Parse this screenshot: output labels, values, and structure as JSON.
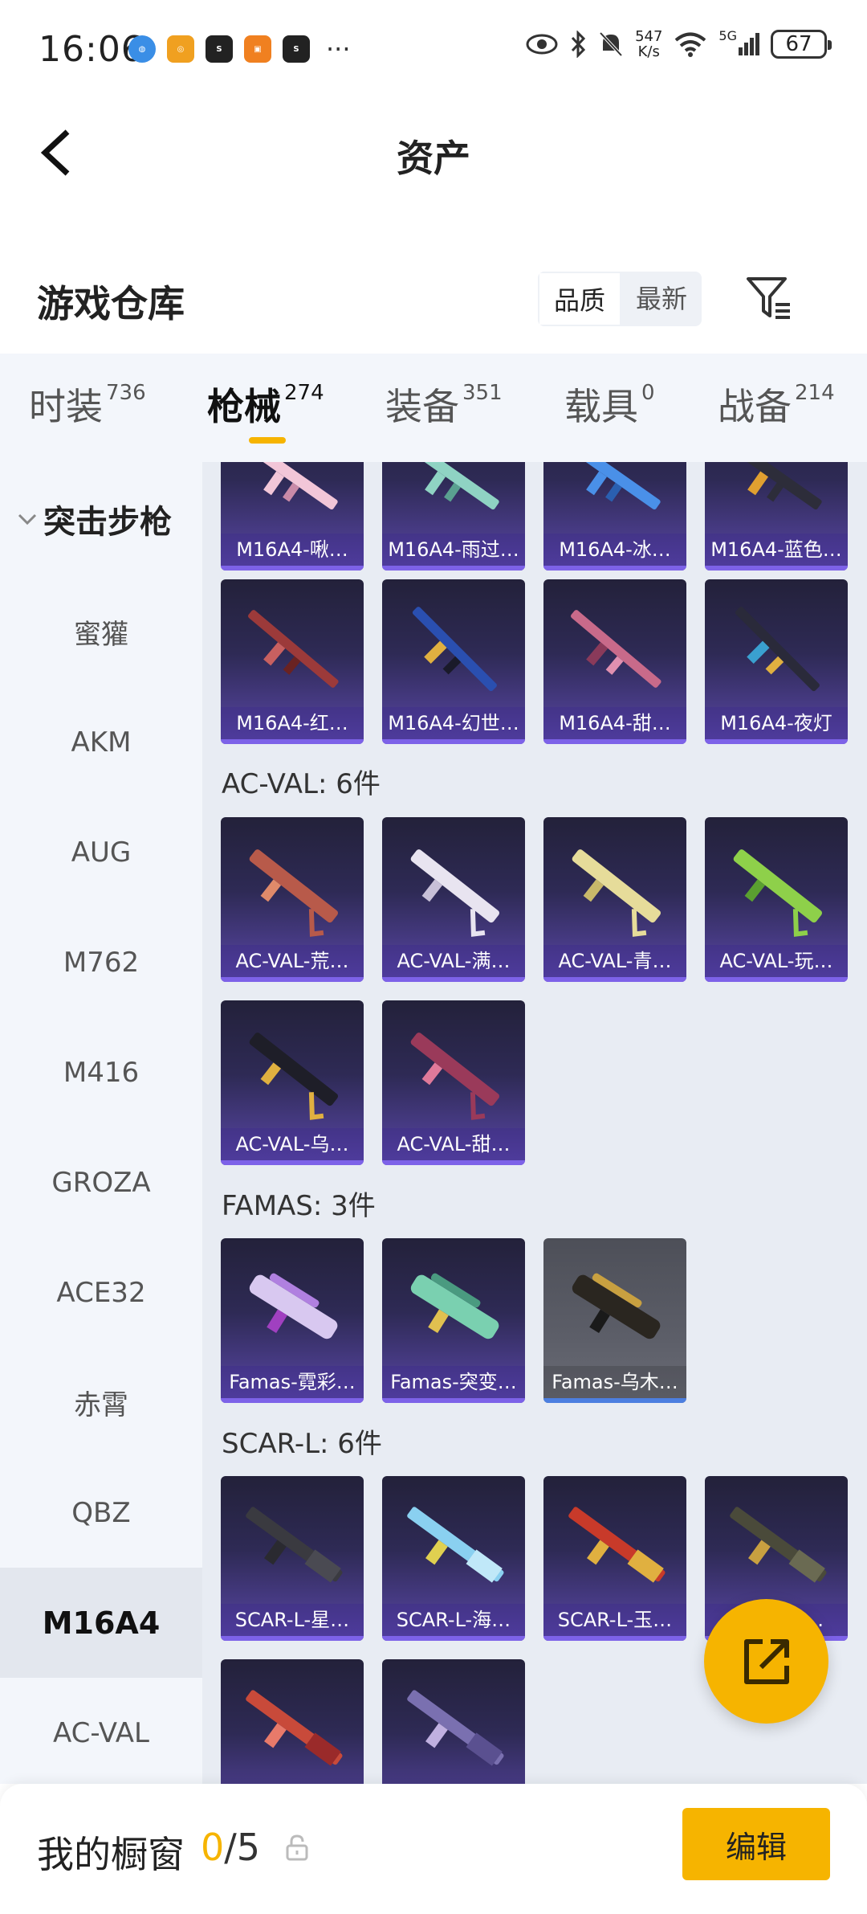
{
  "status_bar": {
    "time": "16:06",
    "speed_value": "547",
    "speed_unit": "K/s",
    "network": "5G",
    "battery": "67"
  },
  "nav": {
    "title": "资产"
  },
  "warehouse": {
    "title": "游戏仓库",
    "sort_quality": "品质",
    "sort_latest": "最新"
  },
  "tabs": [
    {
      "label": "时装",
      "count": "736"
    },
    {
      "label": "枪械",
      "count": "274"
    },
    {
      "label": "装备",
      "count": "351"
    },
    {
      "label": "载具",
      "count": "0"
    },
    {
      "label": "战备",
      "count": "214"
    }
  ],
  "sidebar": {
    "group": "突击步枪",
    "items": [
      "蜜獾",
      "AKM",
      "AUG",
      "M762",
      "M416",
      "GROZA",
      "ACE32",
      "赤霄",
      "QBZ",
      "M16A4",
      "AC-VAL"
    ]
  },
  "grid": {
    "m16_row1": [
      "M16A4-啾…",
      "M16A4-雨过…",
      "M16A4-冰…",
      "M16A4-蓝色…"
    ],
    "m16_row2": [
      "M16A4-红…",
      "M16A4-幻世…",
      "M16A4-甜…",
      "M16A4-夜灯"
    ],
    "acval_title": "AC-VAL: 6件",
    "acval": [
      "AC-VAL-荒…",
      "AC-VAL-满…",
      "AC-VAL-青…",
      "AC-VAL-玩…",
      "AC-VAL-乌…",
      "AC-VAL-甜…"
    ],
    "famas_title": "FAMAS: 3件",
    "famas": [
      "Famas-霓彩…",
      "Famas-突变…",
      "Famas-乌木…"
    ],
    "scar_title": "SCAR-L: 6件",
    "scar": [
      "SCAR-L-星…",
      "SCAR-L-海…",
      "SCAR-L-玉…",
      "SCAR-L-…"
    ]
  },
  "bottom": {
    "title": "我的橱窗",
    "current": "0",
    "total": "/5",
    "edit_label": "编辑"
  },
  "colors": {
    "accent": "#f6b400",
    "card_purple": "#5a47a8",
    "card_grey": "#5c5e68"
  }
}
